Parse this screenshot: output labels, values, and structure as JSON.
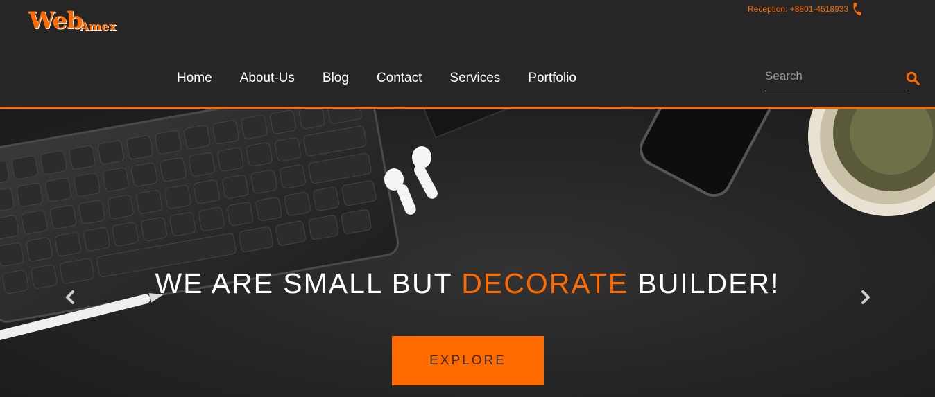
{
  "logo": {
    "primary": "Web",
    "secondary": "Amex"
  },
  "reception": {
    "text": "Reception: +8801-4518933",
    "icon": "phone-icon"
  },
  "nav": {
    "items": [
      {
        "label": "Home"
      },
      {
        "label": "About-Us"
      },
      {
        "label": "Blog"
      },
      {
        "label": "Contact"
      },
      {
        "label": "Services"
      },
      {
        "label": "Portfolio"
      }
    ]
  },
  "search": {
    "placeholder": "Search",
    "value": "",
    "icon": "search-icon"
  },
  "hero": {
    "title_before": "WE ARE SMALL BUT ",
    "title_accent": "DECORATE",
    "title_after": " BUILDER!",
    "cta_label": "EXPLORE",
    "prev_icon": "chevron-left-icon",
    "next_icon": "chevron-right-icon"
  },
  "colors": {
    "accent": "#ff6a00",
    "header_bg": "#262626",
    "hero_bg": "#1e1e1e"
  }
}
